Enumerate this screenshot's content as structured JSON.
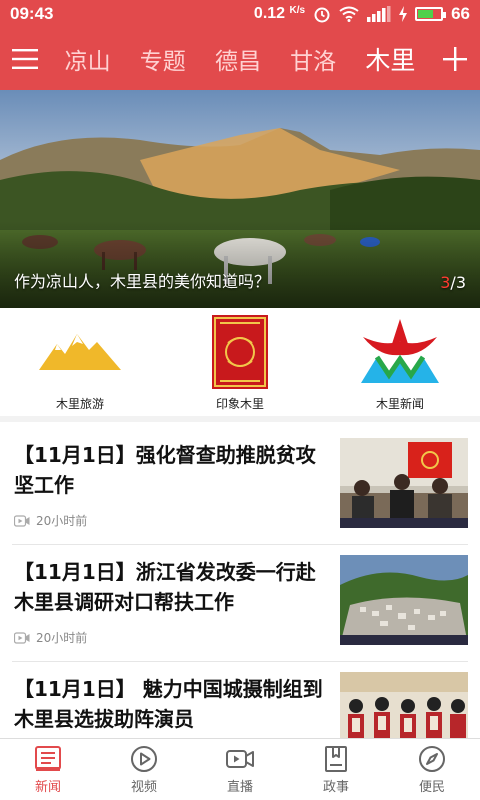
{
  "status_bar": {
    "time": "09:43",
    "net_speed": "0.12",
    "net_unit": "K/s",
    "battery": "66",
    "battery_level": 0.66
  },
  "nav": {
    "channels": [
      {
        "label": "凉山"
      },
      {
        "label": "专题"
      },
      {
        "label": "德昌"
      },
      {
        "label": "甘洛"
      },
      {
        "label": "木里"
      }
    ],
    "active_index": 4
  },
  "banner": {
    "caption": "作为凉山人，木里县的美你知道吗？",
    "current": "3",
    "total": "/3"
  },
  "shortcuts": [
    {
      "label": "木里旅游",
      "icon": "mountain-logo-icon"
    },
    {
      "label": "印象木里",
      "icon": "seal-logo-icon"
    },
    {
      "label": "木里新闻",
      "icon": "news-logo-icon"
    }
  ],
  "news": [
    {
      "title": "【11月1日】强化督查助推脱贫攻坚工作",
      "time": "20小时前"
    },
    {
      "title": "【11月1日】浙江省发改委一行赴木里县调研对口帮扶工作",
      "time": "20小时前"
    },
    {
      "title": "【11月1日】 魅力中国城摄制组到木里县选拔助阵演员",
      "time": ""
    }
  ],
  "tabs": [
    {
      "label": "新闻",
      "icon": "news-icon"
    },
    {
      "label": "视频",
      "icon": "play-icon"
    },
    {
      "label": "直播",
      "icon": "live-camera-icon"
    },
    {
      "label": "政事",
      "icon": "book-icon"
    },
    {
      "label": "便民",
      "icon": "compass-icon"
    }
  ],
  "colors": {
    "brand": "#e24a4c",
    "active_tab": "#e24a4c"
  }
}
